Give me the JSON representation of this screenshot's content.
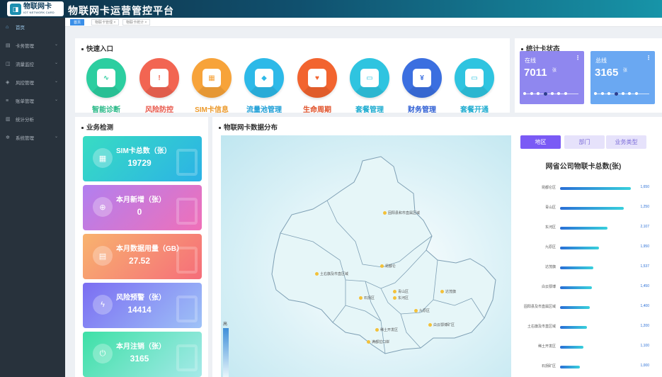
{
  "app": {
    "title": "物联网卡运营管控平台",
    "logo_main": "物联网卡",
    "logo_sub": "IOT NETWORK CARD"
  },
  "sidebar": {
    "items": [
      {
        "label": "首页",
        "icon": "home-icon",
        "active": true
      },
      {
        "label": "卡务管理",
        "icon": "card-icon",
        "chevron": true
      },
      {
        "label": "流量监控",
        "icon": "monitor-icon",
        "chevron": true
      },
      {
        "label": "风控管理",
        "icon": "shield-icon",
        "chevron": true
      },
      {
        "label": "账单管理",
        "icon": "bill-icon",
        "chevron": true
      },
      {
        "label": "统计分析",
        "icon": "chart-icon"
      },
      {
        "label": "系统管理",
        "icon": "gear-icon",
        "chevron": true
      }
    ]
  },
  "tabs": [
    {
      "label": "首页",
      "active": true
    },
    {
      "label": "物联卡管理 ×"
    },
    {
      "label": "物联卡统计 ×"
    }
  ],
  "quick_entry": {
    "title": "快速入口",
    "items": [
      {
        "label": "智能诊断",
        "icon": "diagnosis-icon",
        "color": "#2ccea0",
        "label_color": "#26b886"
      },
      {
        "label": "风险防控",
        "icon": "risk-shield-icon",
        "color": "#f26552",
        "label_color": "#e8574a"
      },
      {
        "label": "SIM卡信息",
        "icon": "sim-card-icon",
        "color": "#f7a33a",
        "label_color": "#ec9a2c"
      },
      {
        "label": "流量池管理",
        "icon": "water-drop-icon",
        "color": "#2db9e8",
        "label_color": "#1c9ed6"
      },
      {
        "label": "生命周期",
        "icon": "heart-pulse-icon",
        "color": "#f2642f",
        "label_color": "#e0512a"
      },
      {
        "label": "套餐管理",
        "icon": "package-icon",
        "color": "#2fc4e0",
        "label_color": "#1facd0"
      },
      {
        "label": "财务管理",
        "icon": "finance-icon",
        "color": "#3b6fe0",
        "label_color": "#2f5fd4"
      },
      {
        "label": "套餐开通",
        "icon": "package-open-icon",
        "color": "#2fc4e0",
        "label_color": "#1facd0"
      }
    ]
  },
  "card_status": {
    "title": "统计卡状态",
    "cards": [
      {
        "label": "在线",
        "value": "7011",
        "unit": "张",
        "color": "#8f87ef"
      },
      {
        "label": "总线",
        "value": "3165",
        "unit": "张",
        "color": "#6aa8f2"
      }
    ]
  },
  "business": {
    "title": "业务检测",
    "items": [
      {
        "label": "SIM卡总数（张）",
        "value": "19729",
        "icon": "sim-card-icon",
        "gradient": "linear-gradient(135deg,#38dcc3,#2bb2e6)"
      },
      {
        "label": "本月新增（张）",
        "value": "0",
        "icon": "add-card-icon",
        "gradient": "linear-gradient(135deg,#b17ff0,#f070b8)"
      },
      {
        "label": "本月数据用量（GB）",
        "value": "27.52",
        "icon": "data-usage-icon",
        "gradient": "linear-gradient(135deg,#f8b36e,#f56d7a)"
      },
      {
        "label": "风险预警（张）",
        "value": "14414",
        "icon": "lightning-icon",
        "gradient": "linear-gradient(135deg,#7b6df2,#9ec2f7)"
      },
      {
        "label": "本月注销（张）",
        "value": "3165",
        "icon": "power-icon",
        "gradient": "linear-gradient(135deg,#3de0a6,#a6e9e9)"
      }
    ]
  },
  "distribution": {
    "title": "物联网卡数据分布",
    "legend_label": "高",
    "cities": [
      "固阳县和市直属区域",
      "土右旗及市直区域",
      "昆都仑",
      "青山区",
      "石拐区",
      "东河区",
      "九原区",
      "稀土开发区",
      "白云鄂博矿区",
      "达茂旗",
      "满都拉口岸"
    ]
  },
  "ranking": {
    "buttons": [
      {
        "label": "地区",
        "active": true
      },
      {
        "label": "部门",
        "active": false
      },
      {
        "label": "业务类型",
        "active": false
      }
    ],
    "title": "网省公司物联卡总数(张)"
  },
  "chart_data": {
    "type": "bar",
    "orientation": "horizontal",
    "title": "网省公司物联卡总数(张)",
    "categories": [
      "昆都仑区",
      "青山区",
      "东河区",
      "九原区",
      "达茂旗",
      "白云鄂博",
      "固阳县及市直属区域",
      "土右旗及市直区域",
      "稀土开发区",
      "石拐矿区"
    ],
    "values": [
      1650,
      1250,
      2107,
      1950,
      1537,
      1450,
      1400,
      1200,
      1100,
      1000
    ],
    "bar_fractions": [
      1.0,
      0.9,
      0.67,
      0.55,
      0.47,
      0.45,
      0.42,
      0.38,
      0.33,
      0.28
    ]
  }
}
